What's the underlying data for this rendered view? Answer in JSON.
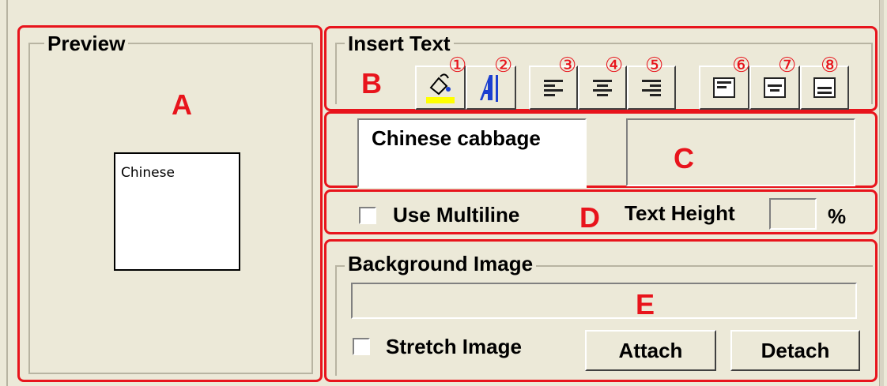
{
  "preview": {
    "legend": "Preview",
    "marker": "A",
    "sample_text": "Chinese"
  },
  "insert_text": {
    "legend": "Insert Text",
    "marker": "B",
    "buttons": [
      {
        "number": "①",
        "icon": "fill-color-icon"
      },
      {
        "number": "②",
        "icon": "text-color-icon"
      },
      {
        "number": "③",
        "icon": "align-left-icon"
      },
      {
        "number": "④",
        "icon": "align-center-icon"
      },
      {
        "number": "⑤",
        "icon": "align-right-icon"
      },
      {
        "number": "⑥",
        "icon": "valign-top-icon"
      },
      {
        "number": "⑦",
        "icon": "valign-middle-icon"
      },
      {
        "number": "⑧",
        "icon": "valign-bottom-icon"
      }
    ],
    "fill_swatch_color": "#ffff00",
    "text_icon_color": "#1b3fd0"
  },
  "text_inputs": {
    "marker": "C",
    "text_value": "Chinese cabbage",
    "secondary_value": ""
  },
  "options": {
    "marker": "D",
    "multiline_label": "Use Multiline",
    "text_height_label": "Text Height",
    "text_height_value": "",
    "percent_label": "%"
  },
  "background": {
    "legend": "Background Image",
    "marker": "E",
    "path_value": "",
    "stretch_label": "Stretch Image",
    "attach_label": "Attach",
    "detach_label": "Detach"
  },
  "colors": {
    "marker_red": "#e8141c",
    "window_bg": "#ece9d8"
  }
}
